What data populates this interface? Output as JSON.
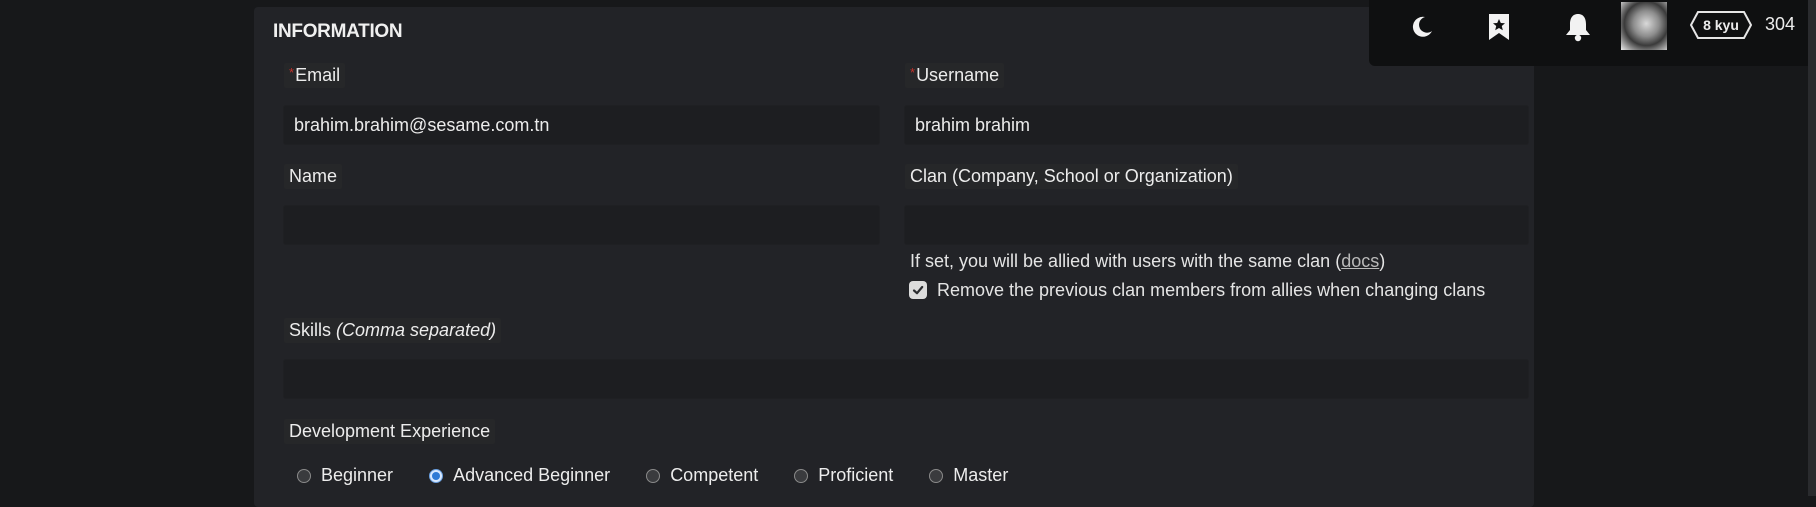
{
  "section": {
    "title": "INFORMATION"
  },
  "form": {
    "email": {
      "label": "Email",
      "required_mark": "*",
      "value": "brahim.brahim@sesame.com.tn"
    },
    "username": {
      "label": "Username",
      "required_mark": "*",
      "value": "brahim brahim"
    },
    "name": {
      "label": "Name",
      "value": ""
    },
    "clan": {
      "label": "Clan (Company, School or Organization)",
      "value": "",
      "note_prefix": "If set, you will be allied with users with the same clan (",
      "note_link": "docs",
      "note_suffix": ")",
      "checkbox_label": "Remove the previous clan members from allies when changing clans",
      "checkbox_checked": true
    },
    "skills": {
      "label": "Skills",
      "hint": "(Comma separated)",
      "value": ""
    },
    "experience": {
      "label": "Development Experience",
      "options": [
        "Beginner",
        "Advanced Beginner",
        "Competent",
        "Proficient",
        "Master"
      ],
      "selected": "Advanced Beginner"
    }
  },
  "topbar": {
    "icons": [
      "moon-icon",
      "bookmark-star-icon",
      "bell-icon"
    ],
    "rank": "8 kyu",
    "honor": "304"
  },
  "colors": {
    "panel": "#222327",
    "background": "#17181a",
    "required": "#c2312b",
    "radio_selected": "#2f7ad6"
  }
}
